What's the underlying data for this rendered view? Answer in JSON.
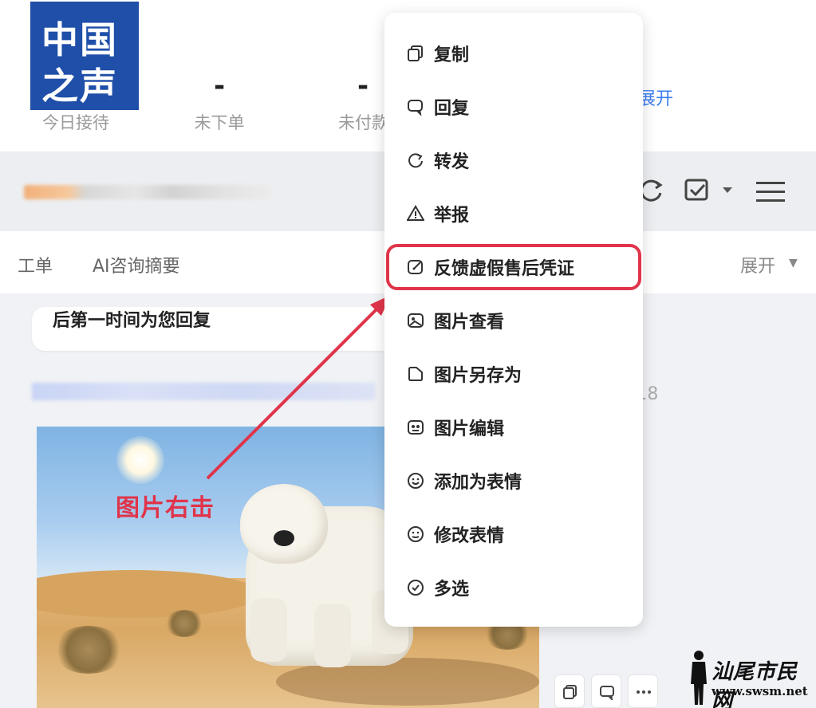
{
  "logo": {
    "line1": "中国",
    "line2": "之声"
  },
  "stats": [
    {
      "value": "",
      "label": "今日接待"
    },
    {
      "value": "-",
      "label": "未下单"
    },
    {
      "value": "-",
      "label": "未付款"
    }
  ],
  "stats_expand": "展开",
  "tabs": [
    {
      "label": "工单"
    },
    {
      "label": "AI咨询摘要"
    }
  ],
  "tabs_expand": "展开",
  "chat": {
    "bubble_text": "后第一时间为您回复",
    "message_time": ":18",
    "image_annotation": "图片右击"
  },
  "context_menu": {
    "items": [
      {
        "label": "复制",
        "icon": "copy-icon"
      },
      {
        "label": "回复",
        "icon": "reply-icon"
      },
      {
        "label": "转发",
        "icon": "forward-icon"
      },
      {
        "label": "举报",
        "icon": "warning-icon"
      },
      {
        "label": "反馈虚假售后凭证",
        "icon": "feedback-icon",
        "highlighted": true
      },
      {
        "label": "图片查看",
        "icon": "image-view-icon"
      },
      {
        "label": "图片另存为",
        "icon": "save-image-icon"
      },
      {
        "label": "图片编辑",
        "icon": "image-edit-icon"
      },
      {
        "label": "添加为表情",
        "icon": "add-emoji-icon"
      },
      {
        "label": "修改表情",
        "icon": "edit-emoji-icon"
      },
      {
        "label": "多选",
        "icon": "multi-select-icon"
      }
    ]
  },
  "watermark": {
    "name": "汕尾市民网",
    "url": "www.swsm.net"
  },
  "colors": {
    "accent": "#3c7ef0",
    "annotation_red": "#e0344a",
    "logo_blue": "#1f4fa8"
  }
}
